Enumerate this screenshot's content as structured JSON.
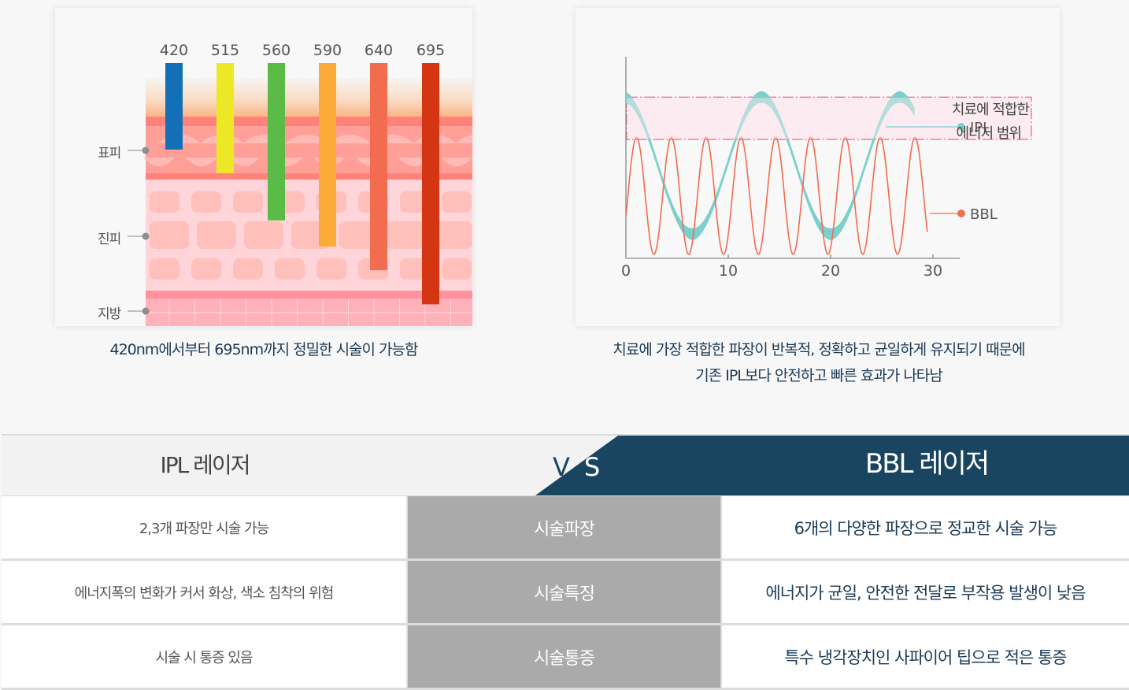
{
  "skin_diagram": {
    "wavelengths": [
      {
        "label": "420",
        "color": "#136fb6",
        "depth_layer": "epidermis",
        "depth_fraction": 0.33
      },
      {
        "label": "515",
        "color": "#ede826",
        "depth_layer": "epidermis",
        "depth_fraction": 0.42
      },
      {
        "label": "560",
        "color": "#5bbb47",
        "depth_layer": "upper-dermis",
        "depth_fraction": 0.6
      },
      {
        "label": "590",
        "color": "#fbab36",
        "depth_layer": "mid-dermis",
        "depth_fraction": 0.7
      },
      {
        "label": "640",
        "color": "#f26c50",
        "depth_layer": "deep-dermis",
        "depth_fraction": 0.79
      },
      {
        "label": "695",
        "color": "#d43613",
        "depth_layer": "fat",
        "depth_fraction": 0.92
      }
    ],
    "layer_labels": [
      {
        "key": "epidermis",
        "label": "표피"
      },
      {
        "key": "dermis",
        "label": "진피"
      },
      {
        "key": "fat",
        "label": "지방"
      }
    ],
    "caption": "420nm에서부터 695nm까지 정밀한 시술이 가능함"
  },
  "chart_data": {
    "type": "line",
    "title": "",
    "xlabel": "",
    "ylabel": "",
    "xlim": [
      0,
      30
    ],
    "x_ticks": [
      "0",
      "10",
      "20",
      "30"
    ],
    "grid": false,
    "band": {
      "label_line1": "치료에 적합한",
      "label_line2": "에너지 범위",
      "y_range_fraction": [
        0.59,
        0.8
      ],
      "color": "#e8457a"
    },
    "series": [
      {
        "name": "IPL",
        "color": "#7ccfca",
        "shape": "sine",
        "period": 13.5,
        "x_range": [
          0,
          28.3
        ],
        "y_min_fraction": 0.12,
        "y_max_fraction": 0.8
      },
      {
        "name": "BBL",
        "color": "#f26c50",
        "shape": "sine",
        "period": 3.4,
        "x_range": [
          0,
          29.5
        ],
        "y_min_fraction": 0.02,
        "y_max_fraction": 0.6
      }
    ],
    "legend": [
      {
        "label": "IPL",
        "color": "#7ccfca"
      },
      {
        "label": "BBL",
        "color": "#f26c50"
      }
    ],
    "legend_placement": "right"
  },
  "wave_caption": {
    "line1": "치료에 가장 적합한 파장이 반복적, 정확하고 균일하게 유지되기 때문에",
    "line2": "기존 IPL보다 안전하고 빠른 효과가 나타남"
  },
  "comparison": {
    "header": {
      "left": "IPL 레이저",
      "vs_v": "V",
      "vs_s": "S",
      "right": "BBL 레이저"
    },
    "colors": {
      "accent": "#1a4560",
      "middle": "#aaaaaa"
    },
    "rows": [
      {
        "ipl": "2,3개 파장만 시술 가능",
        "category": "시술파장",
        "bbl": "6개의 다양한 파장으로 정교한 시술 가능"
      },
      {
        "ipl": "에너지폭의 변화가 커서 화상, 색소 침착의 위험",
        "category": "시술특징",
        "bbl": "에너지가 균일, 안전한 전달로 부작용 발생이 낮음"
      },
      {
        "ipl": "시술 시 통증 있음",
        "category": "시술통증",
        "bbl": "특수 냉각장치인 사파이어 팁으로 적은 통증"
      }
    ]
  }
}
